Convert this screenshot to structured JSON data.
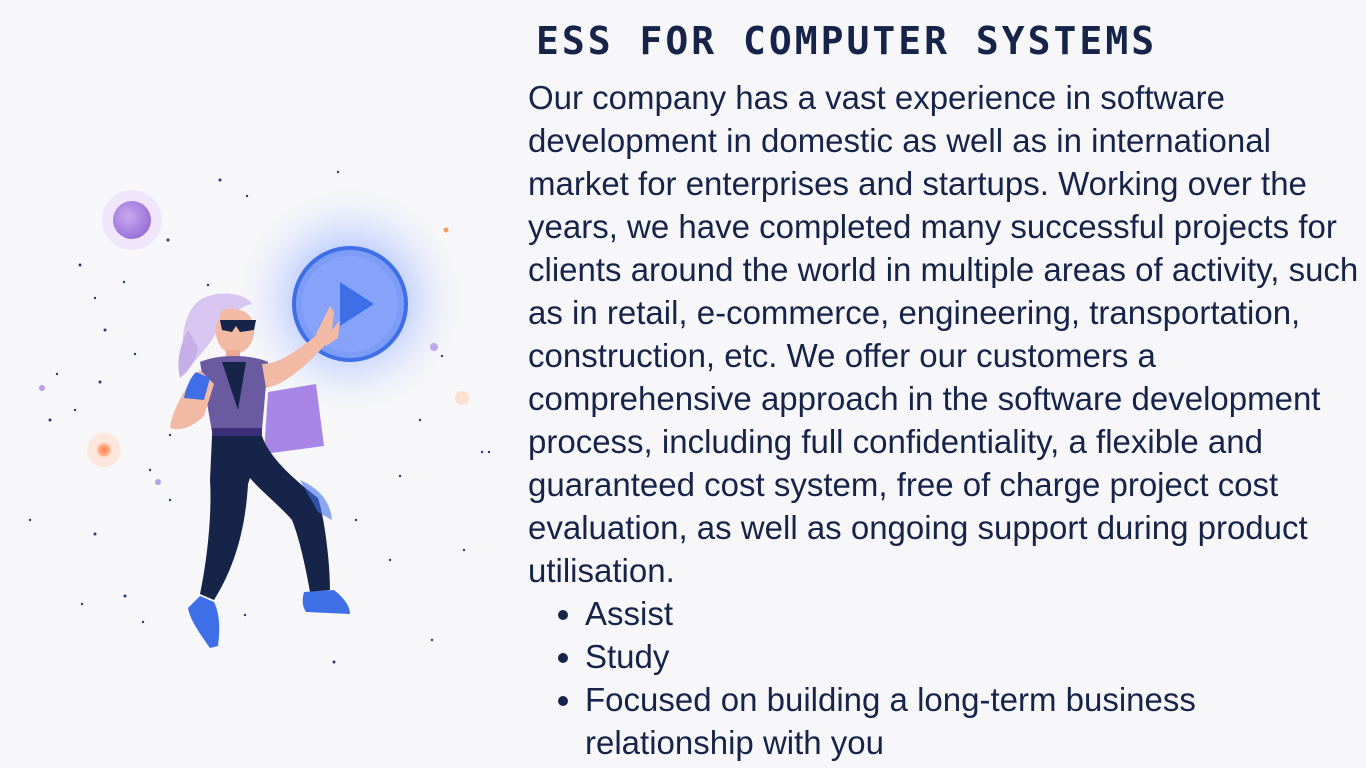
{
  "header": {
    "title": "ESS FOR COMPUTER SYSTEMS"
  },
  "main": {
    "paragraph": "Our company has a vast experience in software development in domestic as well as in international market for enterprises and startups. Working over the years, we have completed many successful projects for clients around the world in multiple areas of activity, such as in retail, e-commerce, engineering, transportation, construction, etc. We offer our customers a comprehensive approach in the software development process, including full confidentiality, a flexible and guaranteed cost system, free of charge project cost evaluation, as well as ongoing support during product utilisation.",
    "bullets": [
      "Assist",
      "Study",
      "Focused on building a long-term business relationship with you"
    ]
  },
  "illustration": {
    "icon": "play-icon",
    "colors": {
      "accent_blue": "#3f6fe6",
      "glow": "#9db6ff",
      "purple": "#8a6bd9",
      "navy": "#17244a",
      "orange": "#f39a6b"
    }
  }
}
